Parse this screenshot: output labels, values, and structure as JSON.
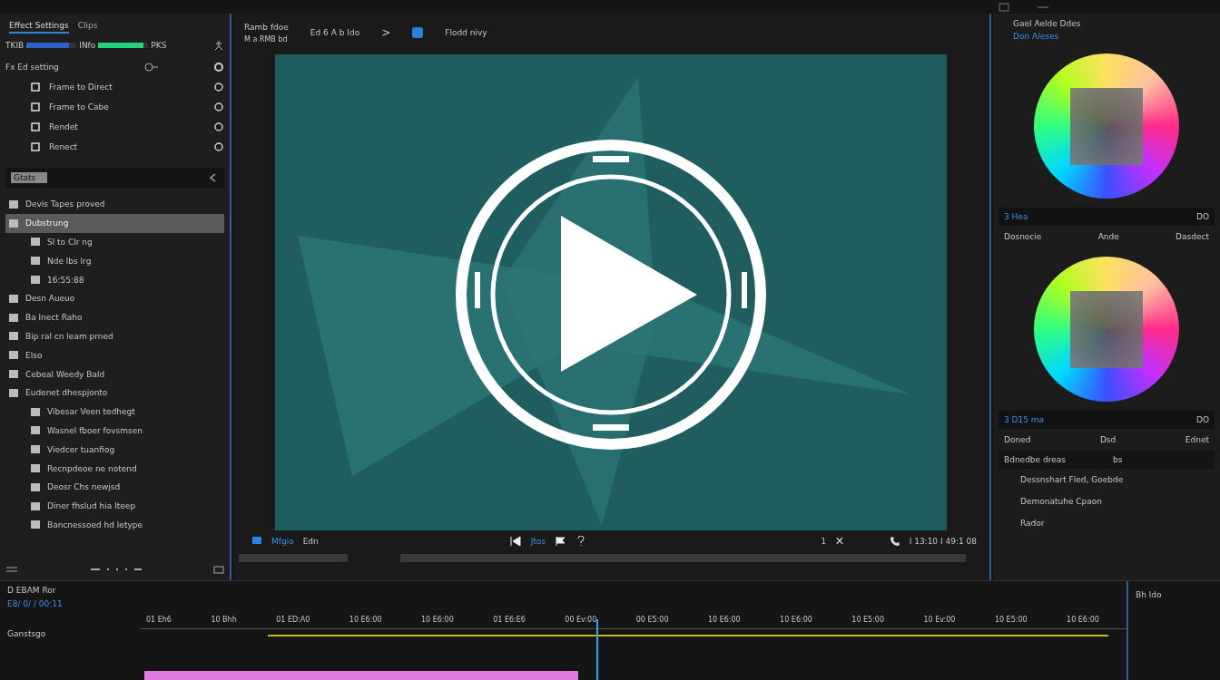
{
  "left_panel": {
    "tabs": [
      {
        "label": "Effect Settings",
        "selected": true
      },
      {
        "label": "Clips",
        "selected": false
      }
    ],
    "meters": [
      {
        "label": "TKIB",
        "level": 0.85,
        "color": "#2f62c8"
      },
      {
        "label": "INfo",
        "level": 0.9,
        "color": "#22d47a"
      }
    ],
    "meter_end": "PKS",
    "header": "Fx Ed setting",
    "effects": [
      {
        "label": "Frame to Direct"
      },
      {
        "label": "Frame to Cabe"
      },
      {
        "label": "Rendet"
      },
      {
        "label": "Renect"
      }
    ],
    "search": {
      "value": "Gtats"
    },
    "bins": [
      {
        "label": "Devis Tapes proved",
        "selected": false
      },
      {
        "label": "Dubstrung",
        "selected": true,
        "children": [
          {
            "label": "Sl to Clr ng",
            "selected": false
          },
          {
            "label": "Nde lbs lrg",
            "selected": false
          },
          {
            "label": "16:55:88",
            "selected": false
          }
        ]
      },
      {
        "label": "Desn Aueuo",
        "selected": false
      },
      {
        "label": "Ba lnect Raho",
        "selected": false
      },
      {
        "label": "Bip ral cn leam prned",
        "selected": false
      },
      {
        "label": "Elso",
        "selected": false
      },
      {
        "label": "Cebeal Weedy Bald",
        "selected": false
      },
      {
        "label": "Eudenet dhespjonto",
        "selected": false,
        "children": [
          {
            "label": "Vibesar Veen tedhegt",
            "selected": false
          },
          {
            "label": "Wasnel fboer fovsmsen",
            "selected": false
          },
          {
            "label": "Viedcer tuanfiog",
            "selected": false
          },
          {
            "label": "Recnpdeoe ne notend",
            "selected": false
          },
          {
            "label": "Deosr Chs newjsd",
            "selected": false
          },
          {
            "label": "Diner fhslud hia Iteep",
            "selected": false
          },
          {
            "label": "Bancnessoed hd letype",
            "selected": false
          }
        ]
      }
    ]
  },
  "viewer": {
    "title": "Ramb fdoe",
    "subtitle": "M a RMB bd",
    "breadcrumb": "Ed 6 A b Ido",
    "separator": ">",
    "sequence": "Flodd nivy",
    "left_label": "Mfgio",
    "left_label_2": "Edn",
    "center_label": "Jtos",
    "marker": "1",
    "close": "×",
    "timecode": "I 13:10 I 49:1 08"
  },
  "right_panel": {
    "title": "Gael Aelde Ddes",
    "subtitle": "Don Aleses",
    "sections": [
      {
        "title": "3 Hea",
        "badge": "DO",
        "columns": [
          "Dosnocie",
          "Ande",
          "Dasdect"
        ]
      },
      {
        "title": "3 D15 ma",
        "badge": "DO",
        "columns": [
          "Doned",
          "Dsd",
          "Ednet"
        ]
      }
    ],
    "field": {
      "label": "Bdnedbe dreas",
      "value": "bs"
    },
    "items": [
      "Dessnshart Fled, Goebde",
      "Demonatuhe Cpaon",
      "Rador"
    ]
  },
  "timeline": {
    "title": "D EBAM Ror",
    "timecode": "E8/ 0/ / 00:11",
    "ruler": [
      "01 Eh6",
      "10 Bhh",
      "01 ED:A0",
      "10 E6:00",
      "10 E6:00",
      "01 E6:E6",
      "00 Ev:00",
      "00 E5:00",
      "10 E6:00",
      "10 E6:00",
      "10 E5:00",
      "10 Ev:00",
      "10 E5:00",
      "10 E6:00"
    ],
    "track": "Ganstsgo",
    "side_label": "Bh ldo"
  }
}
